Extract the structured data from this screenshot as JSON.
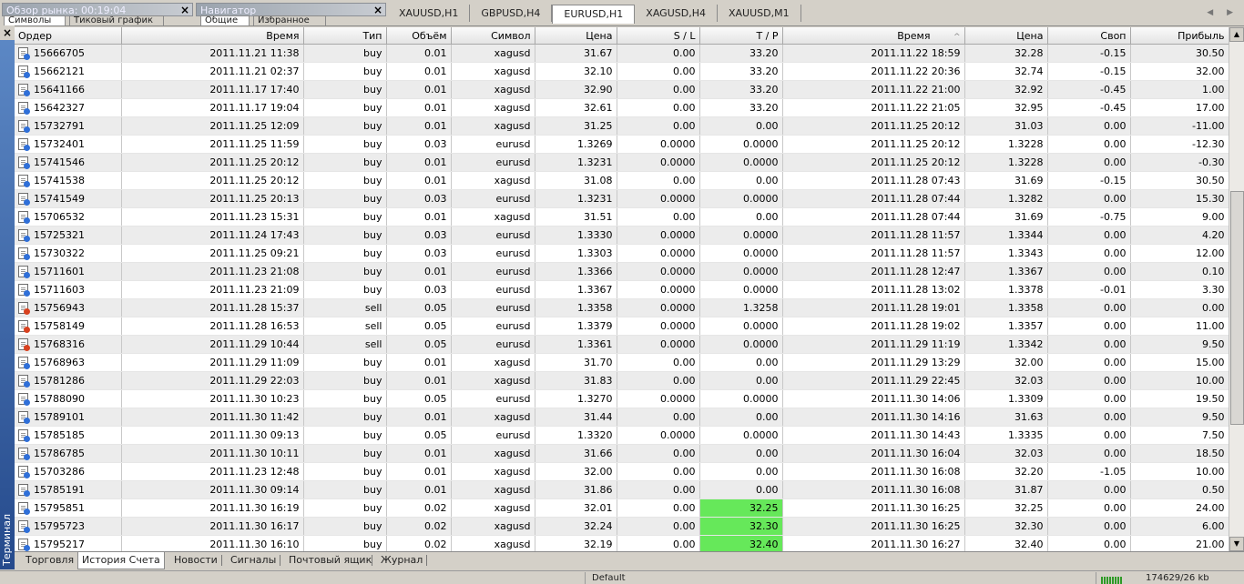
{
  "top": {
    "market_watch_title": "Обзор рынка: 00:19:04",
    "market_watch_tabs": [
      "Символы",
      "Тиковый график"
    ],
    "navigator_title": "Навигатор",
    "navigator_tabs": [
      "Общие",
      "Избранное"
    ],
    "close_glyph": "×",
    "chart_tabs": [
      "XAUUSD,H1",
      "GBPUSD,H4",
      "EURUSD,H1",
      "XAGUSD,H4",
      "XAUUSD,M1"
    ],
    "active_chart_tab": "EURUSD,H1",
    "nav_arrows": "◀ ▶"
  },
  "terminal": {
    "label": "Терминал",
    "close_glyph": "×"
  },
  "table": {
    "columns": [
      "Ордер",
      "Время",
      "Тип",
      "Объём",
      "Символ",
      "Цена",
      "S / L",
      "T / P",
      "Время",
      "Цена",
      "Своп",
      "Прибыль"
    ],
    "sort_indicator": "^",
    "rows": [
      {
        "order": "15666705",
        "open_time": "2011.11.21 11:38",
        "type": "buy",
        "volume": "0.01",
        "symbol": "xagusd",
        "price": "31.67",
        "sl": "0.00",
        "tp": "33.20",
        "close_time": "2011.11.22 18:59",
        "close_price": "32.28",
        "swap": "-0.15",
        "profit": "30.50",
        "tp_hit": false
      },
      {
        "order": "15662121",
        "open_time": "2011.11.21 02:37",
        "type": "buy",
        "volume": "0.01",
        "symbol": "xagusd",
        "price": "32.10",
        "sl": "0.00",
        "tp": "33.20",
        "close_time": "2011.11.22 20:36",
        "close_price": "32.74",
        "swap": "-0.15",
        "profit": "32.00",
        "tp_hit": false
      },
      {
        "order": "15641166",
        "open_time": "2011.11.17 17:40",
        "type": "buy",
        "volume": "0.01",
        "symbol": "xagusd",
        "price": "32.90",
        "sl": "0.00",
        "tp": "33.20",
        "close_time": "2011.11.22 21:00",
        "close_price": "32.92",
        "swap": "-0.45",
        "profit": "1.00",
        "tp_hit": false
      },
      {
        "order": "15642327",
        "open_time": "2011.11.17 19:04",
        "type": "buy",
        "volume": "0.01",
        "symbol": "xagusd",
        "price": "32.61",
        "sl": "0.00",
        "tp": "33.20",
        "close_time": "2011.11.22 21:05",
        "close_price": "32.95",
        "swap": "-0.45",
        "profit": "17.00",
        "tp_hit": false
      },
      {
        "order": "15732791",
        "open_time": "2011.11.25 12:09",
        "type": "buy",
        "volume": "0.01",
        "symbol": "xagusd",
        "price": "31.25",
        "sl": "0.00",
        "tp": "0.00",
        "close_time": "2011.11.25 20:12",
        "close_price": "31.03",
        "swap": "0.00",
        "profit": "-11.00",
        "tp_hit": false
      },
      {
        "order": "15732401",
        "open_time": "2011.11.25 11:59",
        "type": "buy",
        "volume": "0.03",
        "symbol": "eurusd",
        "price": "1.3269",
        "sl": "0.0000",
        "tp": "0.0000",
        "close_time": "2011.11.25 20:12",
        "close_price": "1.3228",
        "swap": "0.00",
        "profit": "-12.30",
        "tp_hit": false
      },
      {
        "order": "15741546",
        "open_time": "2011.11.25 20:12",
        "type": "buy",
        "volume": "0.01",
        "symbol": "eurusd",
        "price": "1.3231",
        "sl": "0.0000",
        "tp": "0.0000",
        "close_time": "2011.11.25 20:12",
        "close_price": "1.3228",
        "swap": "0.00",
        "profit": "-0.30",
        "tp_hit": false
      },
      {
        "order": "15741538",
        "open_time": "2011.11.25 20:12",
        "type": "buy",
        "volume": "0.01",
        "symbol": "xagusd",
        "price": "31.08",
        "sl": "0.00",
        "tp": "0.00",
        "close_time": "2011.11.28 07:43",
        "close_price": "31.69",
        "swap": "-0.15",
        "profit": "30.50",
        "tp_hit": false
      },
      {
        "order": "15741549",
        "open_time": "2011.11.25 20:13",
        "type": "buy",
        "volume": "0.03",
        "symbol": "eurusd",
        "price": "1.3231",
        "sl": "0.0000",
        "tp": "0.0000",
        "close_time": "2011.11.28 07:44",
        "close_price": "1.3282",
        "swap": "0.00",
        "profit": "15.30",
        "tp_hit": false
      },
      {
        "order": "15706532",
        "open_time": "2011.11.23 15:31",
        "type": "buy",
        "volume": "0.01",
        "symbol": "xagusd",
        "price": "31.51",
        "sl": "0.00",
        "tp": "0.00",
        "close_time": "2011.11.28 07:44",
        "close_price": "31.69",
        "swap": "-0.75",
        "profit": "9.00",
        "tp_hit": false
      },
      {
        "order": "15725321",
        "open_time": "2011.11.24 17:43",
        "type": "buy",
        "volume": "0.03",
        "symbol": "eurusd",
        "price": "1.3330",
        "sl": "0.0000",
        "tp": "0.0000",
        "close_time": "2011.11.28 11:57",
        "close_price": "1.3344",
        "swap": "0.00",
        "profit": "4.20",
        "tp_hit": false
      },
      {
        "order": "15730322",
        "open_time": "2011.11.25 09:21",
        "type": "buy",
        "volume": "0.03",
        "symbol": "eurusd",
        "price": "1.3303",
        "sl": "0.0000",
        "tp": "0.0000",
        "close_time": "2011.11.28 11:57",
        "close_price": "1.3343",
        "swap": "0.00",
        "profit": "12.00",
        "tp_hit": false
      },
      {
        "order": "15711601",
        "open_time": "2011.11.23 21:08",
        "type": "buy",
        "volume": "0.01",
        "symbol": "eurusd",
        "price": "1.3366",
        "sl": "0.0000",
        "tp": "0.0000",
        "close_time": "2011.11.28 12:47",
        "close_price": "1.3367",
        "swap": "0.00",
        "profit": "0.10",
        "tp_hit": false
      },
      {
        "order": "15711603",
        "open_time": "2011.11.23 21:09",
        "type": "buy",
        "volume": "0.03",
        "symbol": "eurusd",
        "price": "1.3367",
        "sl": "0.0000",
        "tp": "0.0000",
        "close_time": "2011.11.28 13:02",
        "close_price": "1.3378",
        "swap": "-0.01",
        "profit": "3.30",
        "tp_hit": false
      },
      {
        "order": "15756943",
        "open_time": "2011.11.28 15:37",
        "type": "sell",
        "volume": "0.05",
        "symbol": "eurusd",
        "price": "1.3358",
        "sl": "0.0000",
        "tp": "1.3258",
        "close_time": "2011.11.28 19:01",
        "close_price": "1.3358",
        "swap": "0.00",
        "profit": "0.00",
        "tp_hit": false
      },
      {
        "order": "15758149",
        "open_time": "2011.11.28 16:53",
        "type": "sell",
        "volume": "0.05",
        "symbol": "eurusd",
        "price": "1.3379",
        "sl": "0.0000",
        "tp": "0.0000",
        "close_time": "2011.11.28 19:02",
        "close_price": "1.3357",
        "swap": "0.00",
        "profit": "11.00",
        "tp_hit": false
      },
      {
        "order": "15768316",
        "open_time": "2011.11.29 10:44",
        "type": "sell",
        "volume": "0.05",
        "symbol": "eurusd",
        "price": "1.3361",
        "sl": "0.0000",
        "tp": "0.0000",
        "close_time": "2011.11.29 11:19",
        "close_price": "1.3342",
        "swap": "0.00",
        "profit": "9.50",
        "tp_hit": false
      },
      {
        "order": "15768963",
        "open_time": "2011.11.29 11:09",
        "type": "buy",
        "volume": "0.01",
        "symbol": "xagusd",
        "price": "31.70",
        "sl": "0.00",
        "tp": "0.00",
        "close_time": "2011.11.29 13:29",
        "close_price": "32.00",
        "swap": "0.00",
        "profit": "15.00",
        "tp_hit": false
      },
      {
        "order": "15781286",
        "open_time": "2011.11.29 22:03",
        "type": "buy",
        "volume": "0.01",
        "symbol": "xagusd",
        "price": "31.83",
        "sl": "0.00",
        "tp": "0.00",
        "close_time": "2011.11.29 22:45",
        "close_price": "32.03",
        "swap": "0.00",
        "profit": "10.00",
        "tp_hit": false
      },
      {
        "order": "15788090",
        "open_time": "2011.11.30 10:23",
        "type": "buy",
        "volume": "0.05",
        "symbol": "eurusd",
        "price": "1.3270",
        "sl": "0.0000",
        "tp": "0.0000",
        "close_time": "2011.11.30 14:06",
        "close_price": "1.3309",
        "swap": "0.00",
        "profit": "19.50",
        "tp_hit": false
      },
      {
        "order": "15789101",
        "open_time": "2011.11.30 11:42",
        "type": "buy",
        "volume": "0.01",
        "symbol": "xagusd",
        "price": "31.44",
        "sl": "0.00",
        "tp": "0.00",
        "close_time": "2011.11.30 14:16",
        "close_price": "31.63",
        "swap": "0.00",
        "profit": "9.50",
        "tp_hit": false
      },
      {
        "order": "15785185",
        "open_time": "2011.11.30 09:13",
        "type": "buy",
        "volume": "0.05",
        "symbol": "eurusd",
        "price": "1.3320",
        "sl": "0.0000",
        "tp": "0.0000",
        "close_time": "2011.11.30 14:43",
        "close_price": "1.3335",
        "swap": "0.00",
        "profit": "7.50",
        "tp_hit": false
      },
      {
        "order": "15786785",
        "open_time": "2011.11.30 10:11",
        "type": "buy",
        "volume": "0.01",
        "symbol": "xagusd",
        "price": "31.66",
        "sl": "0.00",
        "tp": "0.00",
        "close_time": "2011.11.30 16:04",
        "close_price": "32.03",
        "swap": "0.00",
        "profit": "18.50",
        "tp_hit": false
      },
      {
        "order": "15703286",
        "open_time": "2011.11.23 12:48",
        "type": "buy",
        "volume": "0.01",
        "symbol": "xagusd",
        "price": "32.00",
        "sl": "0.00",
        "tp": "0.00",
        "close_time": "2011.11.30 16:08",
        "close_price": "32.20",
        "swap": "-1.05",
        "profit": "10.00",
        "tp_hit": false
      },
      {
        "order": "15785191",
        "open_time": "2011.11.30 09:14",
        "type": "buy",
        "volume": "0.01",
        "symbol": "xagusd",
        "price": "31.86",
        "sl": "0.00",
        "tp": "0.00",
        "close_time": "2011.11.30 16:08",
        "close_price": "31.87",
        "swap": "0.00",
        "profit": "0.50",
        "tp_hit": false
      },
      {
        "order": "15795851",
        "open_time": "2011.11.30 16:19",
        "type": "buy",
        "volume": "0.02",
        "symbol": "xagusd",
        "price": "32.01",
        "sl": "0.00",
        "tp": "32.25",
        "close_time": "2011.11.30 16:25",
        "close_price": "32.25",
        "swap": "0.00",
        "profit": "24.00",
        "tp_hit": true
      },
      {
        "order": "15795723",
        "open_time": "2011.11.30 16:17",
        "type": "buy",
        "volume": "0.02",
        "symbol": "xagusd",
        "price": "32.24",
        "sl": "0.00",
        "tp": "32.30",
        "close_time": "2011.11.30 16:25",
        "close_price": "32.30",
        "swap": "0.00",
        "profit": "6.00",
        "tp_hit": true
      },
      {
        "order": "15795217",
        "open_time": "2011.11.30 16:10",
        "type": "buy",
        "volume": "0.02",
        "symbol": "xagusd",
        "price": "32.19",
        "sl": "0.00",
        "tp": "32.40",
        "close_time": "2011.11.30 16:27",
        "close_price": "32.40",
        "swap": "0.00",
        "profit": "21.00",
        "tp_hit": true
      }
    ]
  },
  "colors": {
    "buy_marker": "#2f6fd8",
    "sell_marker": "#d8411f",
    "tp_hit": "#66e85a"
  },
  "bottom_tabs": [
    "Торговля",
    "История Счета",
    "Новости",
    "Сигналы",
    "Почтовый ящик",
    "Журнал"
  ],
  "active_bottom_tab": "История Счета",
  "status": {
    "profile": "Default",
    "traffic": "174629/26 kb"
  },
  "scroll": {
    "up": "▲",
    "down": "▼"
  }
}
